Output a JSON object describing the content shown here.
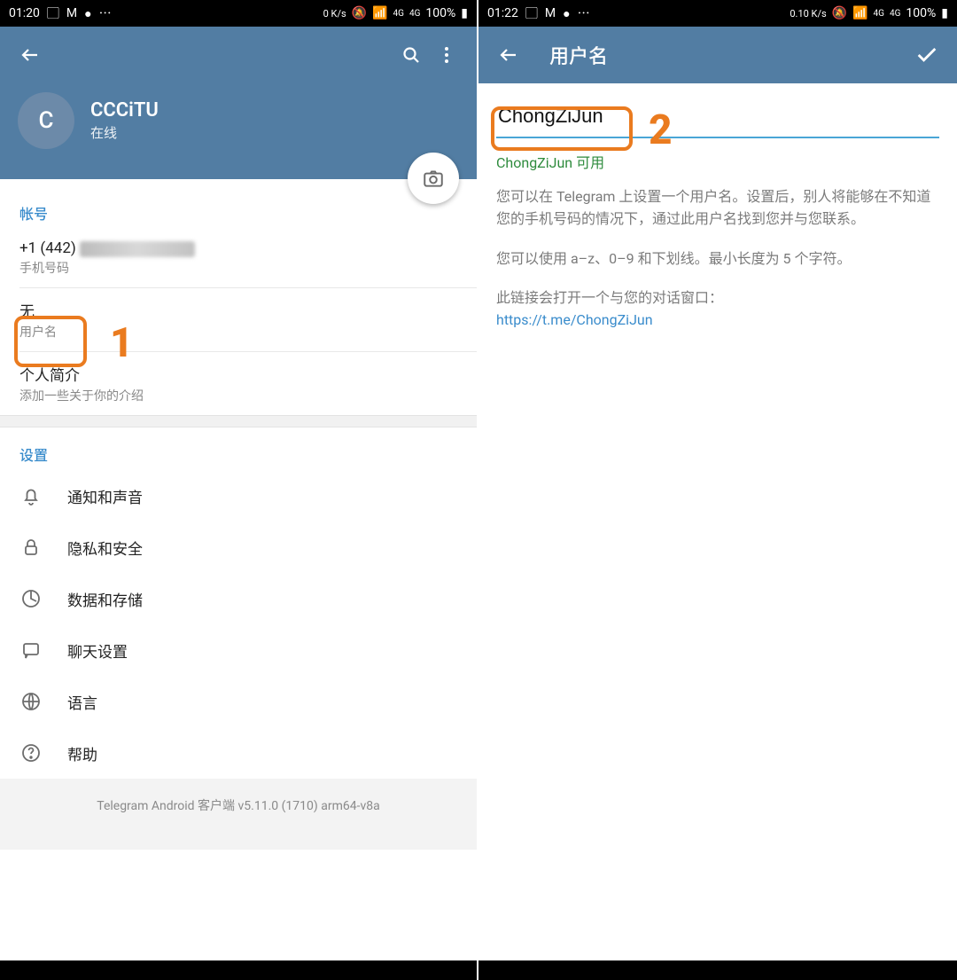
{
  "left": {
    "status": {
      "time": "01:20",
      "speed": "0 K/s",
      "battery": "100%"
    },
    "profile": {
      "avatar_initial": "C",
      "name": "CCCiTU",
      "status": "在线"
    },
    "account": {
      "header": "帐号",
      "phone_prefix": "+1 (442) ",
      "phone_label": "手机号码",
      "username_value": "无",
      "username_label": "用户名",
      "bio_title": "个人简介",
      "bio_hint": "添加一些关于你的介绍"
    },
    "settings": {
      "header": "设置",
      "items": [
        {
          "label": "通知和声音"
        },
        {
          "label": "隐私和安全"
        },
        {
          "label": "数据和存储"
        },
        {
          "label": "聊天设置"
        },
        {
          "label": "语言"
        },
        {
          "label": "帮助"
        }
      ]
    },
    "version": "Telegram Android 客户端 v5.11.0 (1710) arm64-v8a",
    "annotation": "1"
  },
  "right": {
    "status": {
      "time": "01:22",
      "speed": "0.10 K/s",
      "battery": "100%"
    },
    "title": "用户名",
    "input_value": "ChongZiJun",
    "available_text": "ChongZiJun 可用",
    "info_p1": "您可以在 Telegram 上设置一个用户名。设置后，别人将能够在不知道您的手机号码的情况下，通过此用户名找到您并与您联系。",
    "info_p2": "您可以使用 a–z、0–9 和下划线。最小长度为 5 个字符。",
    "info_p3": "此链接会打开一个与您的对话窗口：",
    "link": "https://t.me/ChongZiJun",
    "annotation": "2"
  }
}
